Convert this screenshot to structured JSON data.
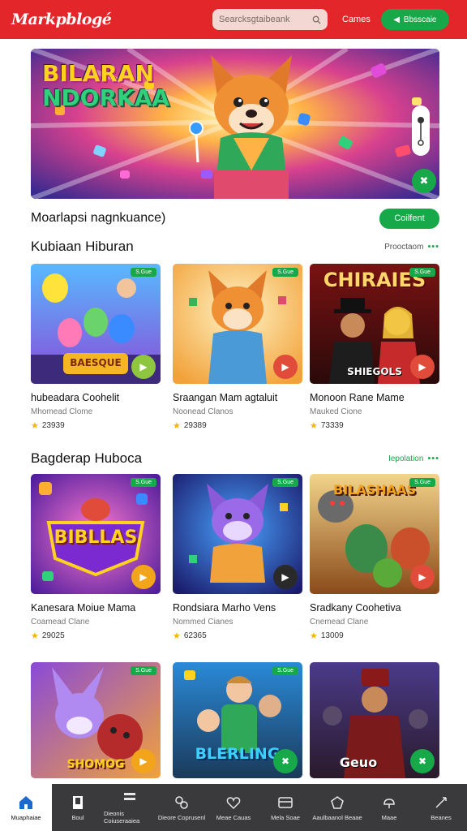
{
  "header": {
    "logo": "Markpblogé",
    "search_placeholder": "Searcksgtaibeank",
    "games_link": "Cames",
    "subscribe_button": "Bbsscaie",
    "accent": "#e3262a",
    "green": "#17a84a"
  },
  "hero": {
    "title_line1": "BILARAN",
    "title_line2": "NDORKAA",
    "play_icon": "shuffle-icon"
  },
  "promo": {
    "text": "Moarlapsi nagnkuance)",
    "button": "Coilfent"
  },
  "sections": [
    {
      "title": "Kubiaan Hiburan",
      "more": "Prooctaom",
      "cards": [
        {
          "name": "hubeadara Coohelit",
          "category": "Mhomead Clome",
          "rating": "23939",
          "thumb_text": "BAESQUE",
          "badge": "S.Gue",
          "action": "play"
        },
        {
          "name": "Sraangan Mam agtaluit",
          "category": "Noonead Clanos",
          "rating": "29389",
          "thumb_text": "",
          "badge": "S.Gue",
          "action": "play"
        },
        {
          "name": "Monoon Rane Mame",
          "category": "Mauked Cione",
          "rating": "73339",
          "thumb_text": "CHIRAIES",
          "thumb_sub": "SHIEGOLS",
          "badge": "S.Gue",
          "action": "play"
        }
      ]
    },
    {
      "title": "Bagderap Huboca",
      "more": "Iepolation",
      "cards": [
        {
          "name": "Kanesara Moiue Mama",
          "category": "Coamead Clane",
          "rating": "29025",
          "thumb_text": "BIBLLAS",
          "badge": "S.Gue",
          "action": "play"
        },
        {
          "name": "Rondsiara Marho Vens",
          "category": "Nommed Cianes",
          "rating": "62365",
          "thumb_text": "",
          "badge": "S.Gue",
          "action": "play"
        },
        {
          "name": "Sradkany Coohetiva",
          "category": "Cnemead Clane",
          "rating": "13009",
          "thumb_text": "BILASHAAS",
          "badge": "S.Gue",
          "action": "play"
        }
      ]
    },
    {
      "title": "",
      "more": "",
      "cards": [
        {
          "name": "",
          "category": "",
          "rating": "",
          "thumb_text": "SHOMOG",
          "badge": "S.Gue",
          "action": "play"
        },
        {
          "name": "",
          "category": "",
          "rating": "",
          "thumb_text": "BLERLING",
          "badge": "S.Gue",
          "action": "close"
        },
        {
          "name": "",
          "category": "",
          "rating": "",
          "thumb_text": "Geuo",
          "badge": "",
          "action": "close"
        }
      ]
    }
  ],
  "bottom_nav": [
    {
      "label": "Muaphaiae",
      "icon": "home-icon",
      "active": true
    },
    {
      "label": "Boul",
      "icon": "bookmark-icon",
      "active": false
    },
    {
      "label": "Dieonis Coiuseraaiea",
      "icon": "grid-icon",
      "active": false
    },
    {
      "label": "Dieore Coprusenl",
      "icon": "puzzle-icon",
      "active": false
    },
    {
      "label": "Meae Cauas",
      "icon": "heart-icon",
      "active": false
    },
    {
      "label": "Mela Soae",
      "icon": "card-icon",
      "active": false
    },
    {
      "label": "Aaulbaanol Beaae",
      "icon": "bug-icon",
      "active": false
    },
    {
      "label": "Maae",
      "icon": "gamepad-icon",
      "active": false
    },
    {
      "label": "Beanes",
      "icon": "user-icon",
      "active": false
    }
  ]
}
